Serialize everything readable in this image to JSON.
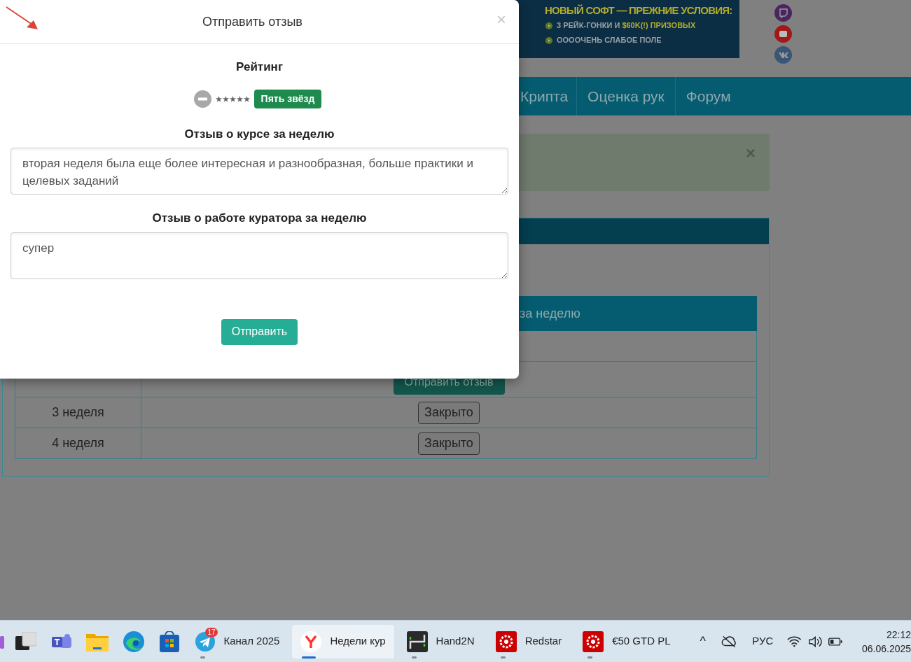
{
  "banner": {
    "headline": "НОВЫЙ СОФТ — ПРЕЖНИЕ УСЛОВИЯ:",
    "bullets": [
      {
        "text": "3 РЕЙК-ГОНКИ И ",
        "highlight": "$60K(!) ПРИЗОВЫХ"
      },
      {
        "text": "ОООOЧЕНЬ СЛАБОЕ ПОЛЕ"
      }
    ]
  },
  "social": [
    {
      "kind": "twitch",
      "color": "#4a2560"
    },
    {
      "kind": "youtube",
      "color": "#a01818"
    },
    {
      "kind": "vk",
      "color": "#3a5575"
    }
  ],
  "nav": [
    "Крипта",
    "Оценка рук",
    "Форум"
  ],
  "alert": {
    "close": "×"
  },
  "table": {
    "header": "за неделю",
    "rows": [
      {
        "action": "Отправить отзыв",
        "kind": "send"
      },
      {
        "week": "3 неделя",
        "action": "Закрыто",
        "kind": "closed"
      },
      {
        "week": "4 неделя",
        "action": "Закрыто",
        "kind": "closed"
      }
    ]
  },
  "modal": {
    "title": "Отправить отзыв",
    "close": "×",
    "rating": {
      "label": "Рейтинг",
      "stars": 5,
      "badge": "Пять звёзд"
    },
    "fields": [
      {
        "label": "Отзыв о курсе за неделю",
        "value": "вторая неделя была еще более интересная и разнообразная, больше практики и целевых заданий"
      },
      {
        "label": "Отзыв о работе куратора за неделю",
        "value": "супер"
      }
    ],
    "submit": "Отправить"
  },
  "taskbar": {
    "apps": [
      {
        "kind": "partial",
        "selected": false,
        "open": false
      },
      {
        "kind": "task-view",
        "selected": false,
        "open": false
      },
      {
        "kind": "teams",
        "selected": false,
        "open": false
      },
      {
        "kind": "folder",
        "selected": false,
        "open": false
      },
      {
        "kind": "edge",
        "selected": false,
        "open": false
      },
      {
        "kind": "store",
        "selected": false,
        "open": false
      },
      {
        "kind": "telegram",
        "label": "Канал 2025",
        "badge": "17",
        "selected": false,
        "open": true
      },
      {
        "kind": "yandex",
        "label": "Недели кур",
        "selected": true,
        "open": true
      },
      {
        "kind": "hand2n",
        "label": "Hand2N",
        "selected": false,
        "open": true
      },
      {
        "kind": "redstar",
        "label": "Redstar",
        "selected": false,
        "open": true
      },
      {
        "kind": "redstar",
        "label": "€50 GTD PL",
        "selected": false,
        "open": true
      }
    ],
    "caret": "^",
    "language": "РУС",
    "time": "22:12",
    "date": "06.06.2025"
  }
}
